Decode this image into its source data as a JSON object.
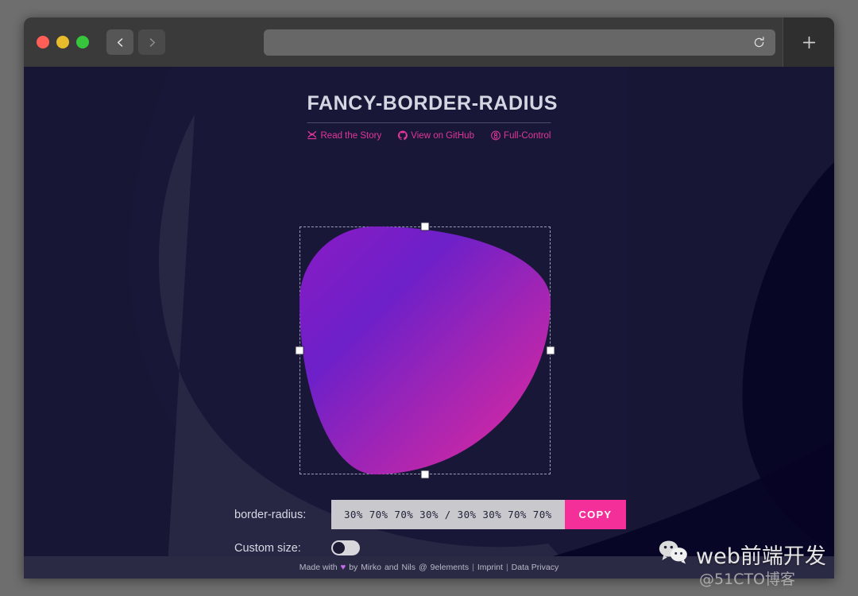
{
  "browser": {
    "window_controls": [
      {
        "name": "close",
        "color": "#ff5f57"
      },
      {
        "name": "minimize",
        "color": "#e8bb2d"
      },
      {
        "name": "zoom",
        "color": "#36c53c"
      }
    ],
    "back_label": "Back",
    "forward_label": "Forward",
    "url_value": "",
    "url_placeholder": "",
    "reload_label": "Reload",
    "newtab_label": "+"
  },
  "page": {
    "title": "FANCY-BORDER-RADIUS",
    "nav_links": [
      {
        "label": "Read the Story",
        "icon": "medium-icon"
      },
      {
        "label": "View on GitHub",
        "icon": "github-icon"
      },
      {
        "label": "Full-Control",
        "icon": "sliders-icon"
      }
    ],
    "shape": {
      "border_radius": "30% 70% 70% 30% / 30% 30% 70% 70%",
      "gradient_from": "#8a1bc4",
      "gradient_to": "#e62a9c",
      "handles": [
        "top",
        "right",
        "bottom",
        "left"
      ]
    },
    "controls": {
      "radius_label": "border-radius:",
      "radius_value": "30% 70% 70% 30%  /  30% 30% 70% 70%",
      "copy_label": "COPY",
      "custom_size_label": "Custom size:",
      "custom_size_on": false
    },
    "footer": {
      "made_with": "Made with",
      "heart": "♥",
      "by": "by",
      "author_1": "Mirko",
      "and": "and",
      "author_2": "Nils",
      "at": "@",
      "company": "9elements",
      "sep": "|",
      "imprint": "Imprint",
      "privacy": "Data Privacy"
    },
    "colors": {
      "background": "#171634",
      "blob_light": "#2a2a47",
      "blob_dark": "#060424",
      "accent_pink": "#f52f99",
      "link_pink": "#e0369a"
    }
  },
  "watermark": {
    "brand": "web前端开发",
    "source": "@51CTO博客"
  }
}
